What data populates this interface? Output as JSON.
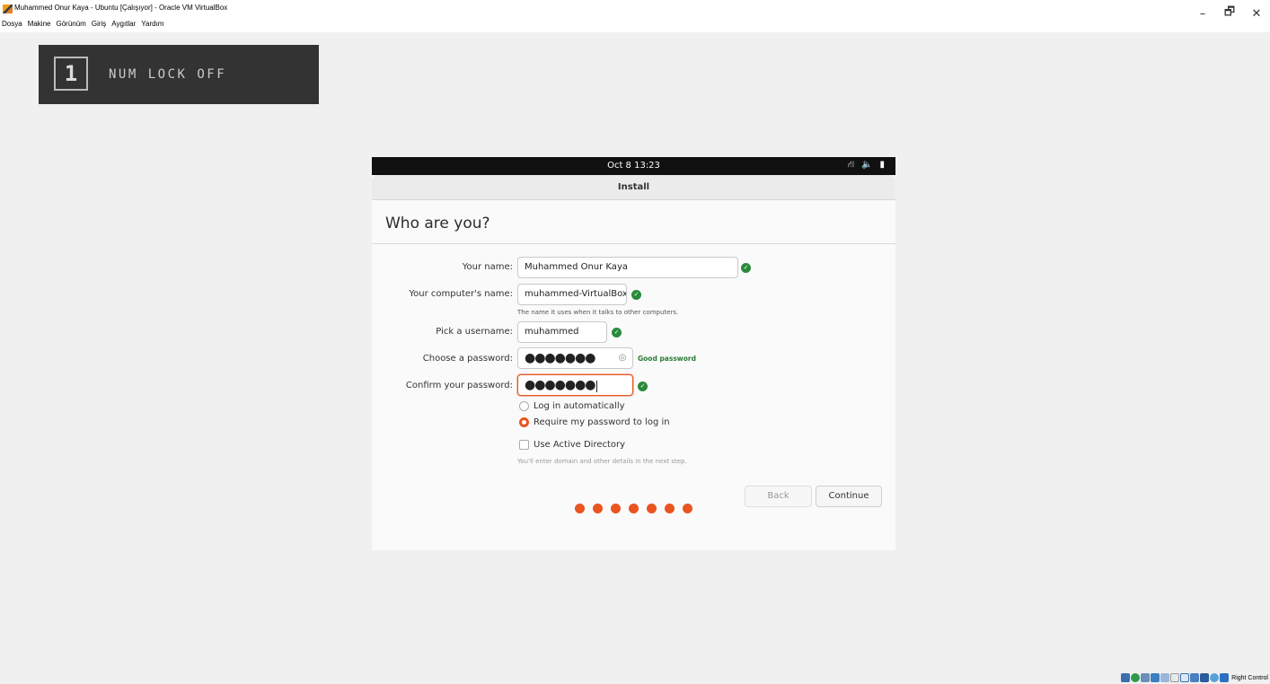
{
  "window": {
    "title": "Muhammed Onur Kaya - Ubuntu [Çalışıyor] - Oracle VM VirtualBox",
    "controls": {
      "minimize": "–",
      "restore": "🗗",
      "close": "✕"
    }
  },
  "menu": [
    "Dosya",
    "Makine",
    "Görünüm",
    "Giriş",
    "Aygıtlar",
    "Yardım"
  ],
  "numlock": {
    "key": "1",
    "text": "NUM LOCK OFF"
  },
  "guest": {
    "datetime": "Oct 8  13:23",
    "tray": {
      "network": "⛙",
      "volume": "🔈",
      "battery": "▮"
    },
    "header_title": "Install",
    "page_title": "Who are you?",
    "form": {
      "name_label": "Your name:",
      "name_value": "Muhammed Onur Kaya",
      "computer_label": "Your computer's name:",
      "computer_value": "muhammed-VirtualBox",
      "computer_hint": "The name it uses when it talks to other computers.",
      "username_label": "Pick a username:",
      "username_value": "muhammed",
      "password_label": "Choose a password:",
      "password_value": "●●●●●●●",
      "password_strength": "Good password",
      "confirm_label": "Confirm your password:",
      "confirm_value": "●●●●●●●"
    },
    "options": {
      "auto_login": "Log in automatically",
      "require_password": "Require my password to log in",
      "active_directory": "Use Active Directory",
      "ad_hint": "You'll enter domain and other details in the next step."
    },
    "buttons": {
      "back": "Back",
      "continue": "Continue"
    },
    "progress": {
      "total_steps": 7
    }
  },
  "statusbar": {
    "host_key": "Right Control"
  },
  "colors": {
    "accent": "#e95420",
    "ok": "#2a8a3c"
  }
}
